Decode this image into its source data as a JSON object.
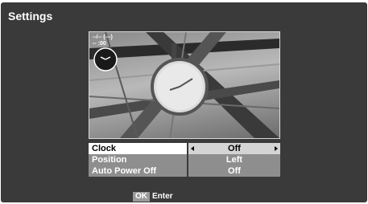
{
  "title": "Settings",
  "preview": {
    "osd_line1": "--/-- (---)",
    "osd_line2": "-- :00",
    "clock_icon": "clock-icon"
  },
  "menu": {
    "rows": [
      {
        "label": "Clock",
        "value": "Off"
      },
      {
        "label": "Position",
        "value": "Left"
      },
      {
        "label": "Auto Power Off",
        "value": "Off"
      }
    ]
  },
  "footer": {
    "ok_label": "OK",
    "action": "Enter"
  },
  "colors": {
    "background": "#3a3a3a",
    "selected_label_bg": "#ffffff",
    "selected_value_bg": "#d4d4d4",
    "row_bg": "#8e8e8e"
  }
}
